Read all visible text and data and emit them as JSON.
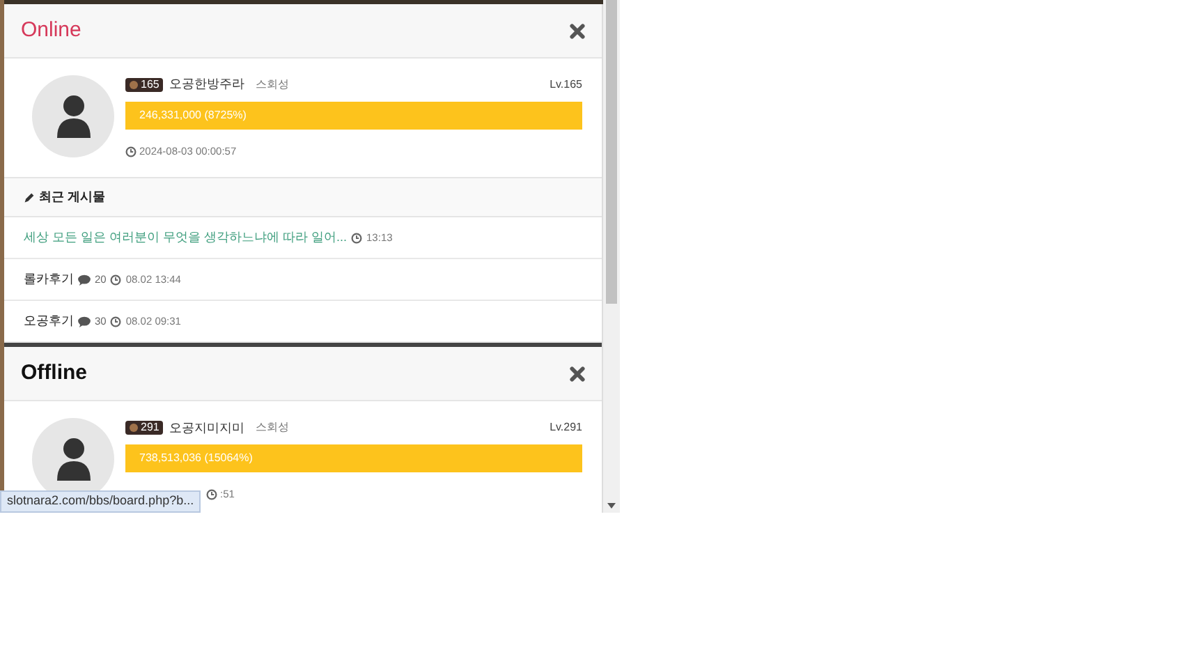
{
  "panels": [
    {
      "title": "Online",
      "kind": "online",
      "level_badge": "165",
      "name": "오공한방주라",
      "action": "스회성",
      "lv": "Lv.165",
      "exp": "246,331,000 (8725%)",
      "date": "2024-08-03 00:00:57",
      "recent": {
        "heading": "최근 게시물",
        "posts": [
          {
            "title": "세상 모든 일은 여러분이 무엇을 생각하느냐에 따라 일어...",
            "highlighted": true,
            "time": "13:13"
          },
          {
            "title": "롤카후기",
            "highlighted": false,
            "comments": "20",
            "time": "08.02 13:44"
          },
          {
            "title": "오공후기",
            "highlighted": false,
            "comments": "30",
            "time": "08.02 09:31"
          }
        ]
      }
    },
    {
      "title": "Offline",
      "kind": "offline",
      "level_badge": "291",
      "name": "오공지미지미",
      "action": "스회성",
      "lv": "Lv.291",
      "exp": "738,513,036 (15064%)",
      "date": ":51"
    }
  ],
  "status_url": "slotnara2.com/bbs/board.php?b..."
}
